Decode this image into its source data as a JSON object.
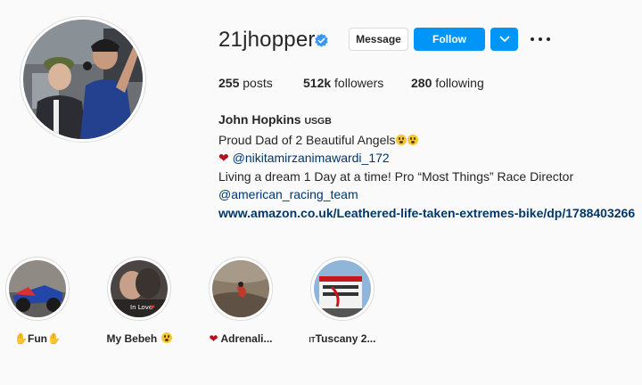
{
  "profile": {
    "username": "21jhopper",
    "verified": true,
    "avatar": "profile-photo-two-people-racing-pit",
    "accent_color": "#0095f6"
  },
  "actions": {
    "message_label": "Message",
    "follow_label": "Follow"
  },
  "stats": {
    "posts_count": "255",
    "posts_label": "posts",
    "followers_count": "512k",
    "followers_label": "followers",
    "following_count": "280",
    "following_label": "following"
  },
  "bio": {
    "full_name": "John Hopkins",
    "name_flag": "USGB",
    "line1": "Proud Dad of 2 Beautiful Angels",
    "mention": "@nikitamirzanimawardi_172",
    "line3": "Living a dream 1 Day at a time! Pro “Most Things” Race Director",
    "team_mention": "@american_racing_team",
    "website": "www.amazon.co.uk/Leathered-life-taken-extremes-bike/dp/1788403266"
  },
  "highlights": [
    {
      "label": "Fun",
      "prefix_icon": "hand-icon",
      "suffix_icon": "hand-icon"
    },
    {
      "label": "My Bebeh",
      "suffix_icon": "surprised-face-icon",
      "overlay_text": "In Love"
    },
    {
      "label": "Adrenali...",
      "prefix_icon": "heart-icon"
    },
    {
      "label": "Tuscany 2...",
      "prefix": "IT"
    }
  ]
}
